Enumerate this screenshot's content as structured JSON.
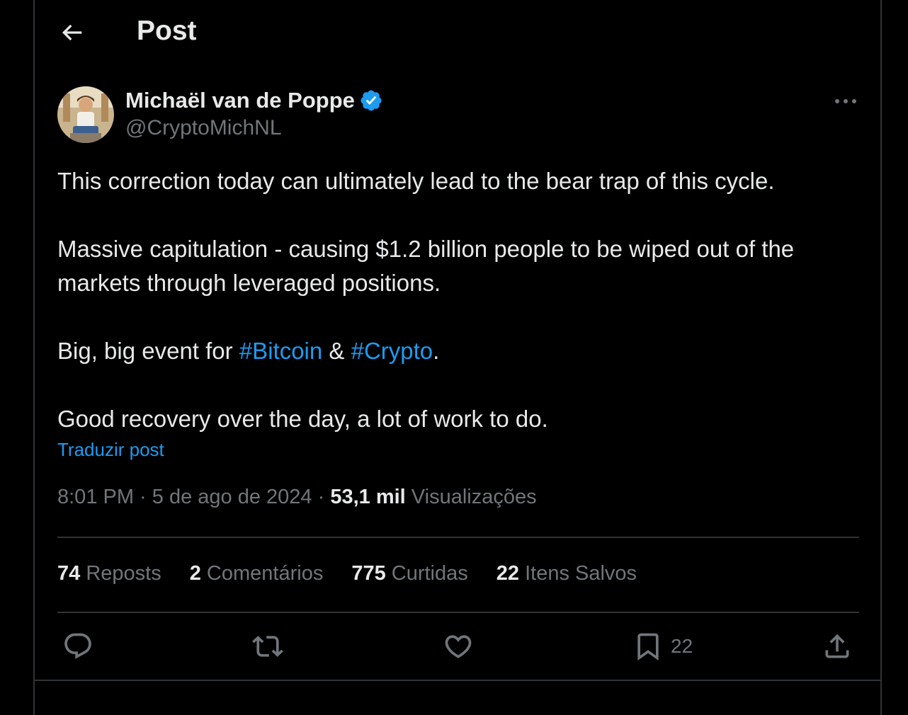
{
  "header": {
    "title": "Post"
  },
  "author": {
    "name": "Michaël van de Poppe",
    "handle": "@CryptoMichNL",
    "verified": true
  },
  "tweet": {
    "line1": "This correction today can ultimately lead to the bear trap of this cycle.",
    "line2": "Massive capitulation - causing $1.2 billion people to be wiped out of the markets through leveraged positions.",
    "line3_prefix": "Big, big event for ",
    "hashtag1": "#Bitcoin",
    "line3_mid": " & ",
    "hashtag2": "#Crypto",
    "line3_suffix": ".",
    "line4": "Good recovery over the day, a lot of work to do."
  },
  "translate_label": "Traduzir post",
  "meta": {
    "time": "8:01 PM",
    "sep1": " · ",
    "date": "5 de ago de 2024",
    "sep2": " · ",
    "views_count": "53,1 mil",
    "views_label": " Visualizações"
  },
  "stats": {
    "reposts_count": "74",
    "reposts_label": " Reposts",
    "comments_count": "2",
    "comments_label": " Comentários",
    "likes_count": "775",
    "likes_label": " Curtidas",
    "saves_count": "22",
    "saves_label": " Itens Salvos"
  },
  "actions": {
    "bookmark_count": "22"
  },
  "icons": [
    "back-arrow-icon",
    "verified-badge-icon",
    "more-icon",
    "reply-icon",
    "repost-icon",
    "like-icon",
    "bookmark-icon",
    "share-icon"
  ],
  "colors": {
    "background": "#000000",
    "text": "#e7e9ea",
    "muted": "#71767b",
    "accent": "#1d9bf0",
    "divider": "#2f3336"
  }
}
